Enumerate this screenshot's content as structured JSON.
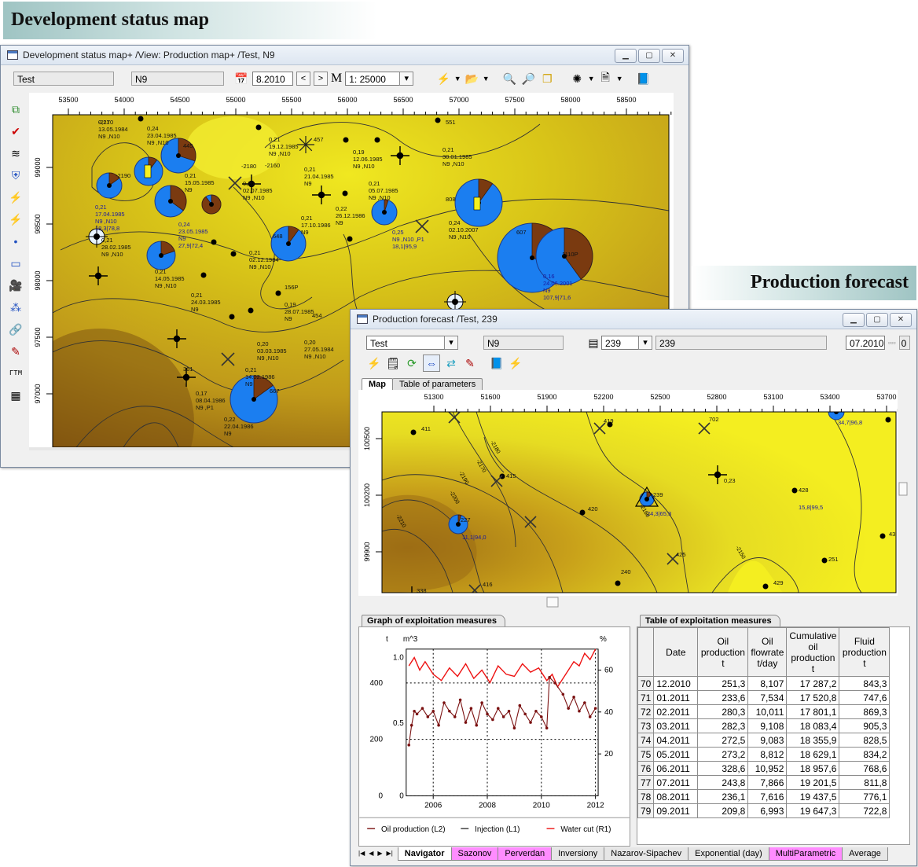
{
  "banners": {
    "dev": "Development status map",
    "forecast": "Production  forecast"
  },
  "map_window": {
    "title": "Development status map+ /View: Production map+ /Test, N9",
    "toolbar": {
      "project": "Test",
      "layer": "N9",
      "date": "8.2010",
      "scale_prefix": "M",
      "scale": "1: 25000"
    },
    "x_ticks": [
      "53500",
      "54000",
      "54500",
      "55000",
      "55500",
      "56000",
      "56500",
      "57000",
      "57500",
      "58000",
      "58500"
    ],
    "y_ticks": [
      "99000",
      "98500",
      "98000",
      "97500",
      "97000"
    ],
    "labels": [
      "0,21\n13.05.1984\nN9 ,N10",
      "0,24\n23.04.1985\nN9 ,N10",
      "445",
      "0,21\n17.04.1985\nN9 ,N10\n18,3|78,8",
      "0,21\n15.05.1985\nN9",
      "0,24\n23.05.1985\nN9\n27,9|72,4",
      "0,21\n28.02.1985\nN9 ,N10",
      "0,21\n14.05.1985\nN9 ,N10",
      "0,20\n02.07.1985\nN9 ,N10",
      "0,21\n19.12.1985\nN9 ,N10",
      "457",
      "0,21\n17.10.1986\nN9",
      "0,21\n21.04.1985\nN9",
      "648",
      "0,21\n02.12.1984\nN9 ,N10",
      "0,22\n26.12.1986\nN9",
      "0,19\n12.06.1985\nN9 ,N10",
      "0,21\n05.07.1985\nN9 ,N10",
      "0,25\nN9 ,N10 ,P1\n18,1|95,9",
      "551",
      "0,21\n30.01.1985\nN9 ,N10",
      "808",
      "0,24\n02.10.2007\nN9 ,N10",
      "607",
      "1110P",
      "0,16\n24.06.2001\nN9\n107,9|71,6",
      "156P",
      "0,19\n28.07.1985\nN9",
      "454",
      "0,21\n24.03.1985\nN9",
      "0,20\n27.05.1984\nN9 ,N10",
      "0,20\n03.03.1985\nN9 ,N10",
      "361",
      "0,17\n08.04.1986\nN9 ,P1",
      "0,21\n14.02.1986\nN9",
      "667",
      "0,22\n22.04.1986\nN9",
      "-2190",
      "-2180",
      "-2160",
      "-2170"
    ]
  },
  "forecast_window": {
    "title": "Production forecast /Test, 239",
    "toolbar": {
      "project": "Test",
      "layer": "N9",
      "well": "239",
      "well_field": "239",
      "date": "07.2010",
      "extra": "0"
    },
    "tabs": [
      "Map",
      "Table of parameters"
    ],
    "x_ticks": [
      "51300",
      "51600",
      "51900",
      "52200",
      "52500",
      "52800",
      "53100",
      "53400",
      "53700"
    ],
    "y_ticks": [
      "100500",
      "100200",
      "99900"
    ],
    "well_labels": [
      "411",
      "419",
      "702",
      "415",
      "420",
      "239",
      "24,3|65,3",
      "428",
      "15,8|99,5",
      "227",
      "11,1|94,0",
      "425",
      "240",
      "251",
      "429",
      "432",
      "34,7|96,8",
      "416",
      "338",
      "0,23"
    ],
    "graph_title": "Graph of exploitation measures",
    "table_title": "Table of exploitation measures",
    "table": {
      "headers": [
        "",
        "Date",
        "Oil production t",
        "Oil flowrate t/day",
        "Cumulative oil production t",
        "Fluid production t"
      ],
      "rows": [
        [
          "70",
          "12.2010",
          "251,3",
          "8,107",
          "17 287,2",
          "843,3"
        ],
        [
          "71",
          "01.2011",
          "233,6",
          "7,534",
          "17 520,8",
          "747,6"
        ],
        [
          "72",
          "02.2011",
          "280,3",
          "10,011",
          "17 801,1",
          "869,3"
        ],
        [
          "73",
          "03.2011",
          "282,3",
          "9,108",
          "18 083,4",
          "905,3"
        ],
        [
          "74",
          "04.2011",
          "272,5",
          "9,083",
          "18 355,9",
          "828,5"
        ],
        [
          "75",
          "05.2011",
          "273,2",
          "8,812",
          "18 629,1",
          "834,2"
        ],
        [
          "76",
          "06.2011",
          "328,6",
          "10,952",
          "18 957,6",
          "768,6"
        ],
        [
          "77",
          "07.2011",
          "243,8",
          "7,866",
          "19 201,5",
          "811,8"
        ],
        [
          "78",
          "08.2011",
          "236,1",
          "7,616",
          "19 437,5",
          "776,1"
        ],
        [
          "79",
          "09.2011",
          "209,8",
          "6,993",
          "19 647,3",
          "722,8"
        ]
      ]
    },
    "bottom_tabs": [
      "Navigator",
      "Sazonov",
      "Perverdan",
      "Inversiony",
      "Nazarov-Sipachev",
      "Exponential (day)",
      "MultiParametric",
      "Average"
    ],
    "nav_buttons": [
      "|◀",
      "◀",
      "▶",
      "▶|"
    ]
  },
  "chart_data": {
    "type": "line",
    "title": "",
    "xlabel": "",
    "ylabel_left_outer": "t",
    "ylabel_left_inner": "m^3",
    "ylabel_right": "%",
    "x_range": [
      2005.0,
      2012.1
    ],
    "x_ticks": [
      "2006",
      "2008",
      "2010",
      "2012"
    ],
    "y_outer_ticks": [
      "0",
      "200",
      "400"
    ],
    "y_outer_range": [
      0,
      520
    ],
    "y_inner_ticks": [
      "0",
      "0.5",
      "1.0"
    ],
    "y_right_ticks": [
      "20",
      "40",
      "60"
    ],
    "y_right_range": [
      0,
      70
    ],
    "legend": [
      "Oil production (L2)",
      "Injection (L1)",
      "Water cut (R1)"
    ],
    "colors": {
      "oil": "#7a1010",
      "injection": "#333333",
      "water_cut": "#ee1111"
    },
    "series": [
      {
        "name": "Oil production (L2)",
        "axis": "outer",
        "x": [
          2005.1,
          2005.2,
          2005.3,
          2005.4,
          2005.6,
          2005.8,
          2006.0,
          2006.2,
          2006.4,
          2006.6,
          2006.8,
          2007.0,
          2007.2,
          2007.4,
          2007.6,
          2007.8,
          2008.0,
          2008.2,
          2008.4,
          2008.6,
          2008.8,
          2009.0,
          2009.2,
          2009.4,
          2009.6,
          2009.8,
          2010.0,
          2010.2,
          2010.3,
          2010.5,
          2010.8,
          2011.0,
          2011.2,
          2011.4,
          2011.6,
          2011.8,
          2012.0
        ],
        "y": [
          180,
          250,
          300,
          290,
          310,
          280,
          300,
          250,
          330,
          300,
          280,
          340,
          260,
          310,
          250,
          330,
          290,
          270,
          310,
          280,
          300,
          240,
          320,
          290,
          260,
          300,
          280,
          240,
          420,
          400,
          360,
          310,
          350,
          300,
          330,
          280,
          310
        ]
      },
      {
        "name": "Water cut (R1)",
        "axis": "right",
        "x": [
          2005.1,
          2005.3,
          2005.5,
          2005.7,
          2006.0,
          2006.3,
          2006.6,
          2006.9,
          2007.2,
          2007.5,
          2007.8,
          2008.1,
          2008.4,
          2008.7,
          2009.0,
          2009.3,
          2009.6,
          2009.9,
          2010.2,
          2010.4,
          2010.6,
          2010.8,
          2011.0,
          2011.2,
          2011.4,
          2011.6,
          2011.8,
          2012.0
        ],
        "y": [
          62,
          66,
          60,
          64,
          58,
          55,
          61,
          57,
          63,
          56,
          60,
          54,
          62,
          58,
          57,
          63,
          59,
          61,
          55,
          58,
          52,
          56,
          60,
          64,
          62,
          68,
          65,
          70
        ]
      }
    ]
  }
}
